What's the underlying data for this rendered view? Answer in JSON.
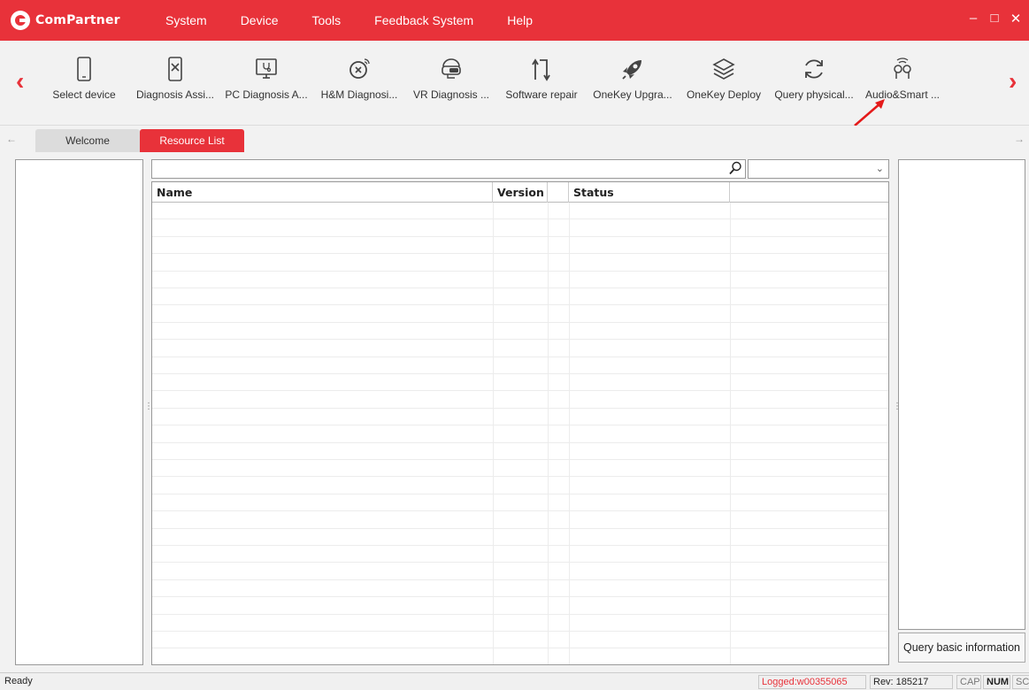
{
  "app": {
    "logo_text": "ComPartner",
    "brand_color": "#e8323a"
  },
  "menu": {
    "items": [
      "System",
      "Device",
      "Tools",
      "Feedback System",
      "Help"
    ]
  },
  "window_controls": {
    "minimize": "–",
    "maximize": "□",
    "close": "✕"
  },
  "toolbar": {
    "prev_arrow": "‹",
    "next_arrow": "›",
    "items": [
      {
        "label": "Select device",
        "icon": "phone-icon"
      },
      {
        "label": "Diagnosis Assi...",
        "icon": "diagnosis-phone-icon"
      },
      {
        "label": "PC Diagnosis A...",
        "icon": "pc-diagnosis-icon"
      },
      {
        "label": "H&M Diagnosi...",
        "icon": "watch-icon"
      },
      {
        "label": "VR Diagnosis ...",
        "icon": "vr-headset-icon"
      },
      {
        "label": "Software repair",
        "icon": "software-repair-icon"
      },
      {
        "label": "OneKey Upgra...",
        "icon": "rocket-icon"
      },
      {
        "label": "OneKey Deploy",
        "icon": "layers-icon"
      },
      {
        "label": "Query physical...",
        "icon": "refresh-icon"
      },
      {
        "label": "Audio&Smart ...",
        "icon": "earbuds-icon"
      }
    ]
  },
  "tabs": {
    "back_arrow": "←",
    "forward_arrow": "→",
    "items": [
      {
        "label": "Welcome",
        "active": false
      },
      {
        "label": "Resource List",
        "active": true
      }
    ]
  },
  "resource_list": {
    "search_value": "",
    "filter_value": "",
    "columns": [
      "Name",
      "Version",
      "",
      "Status",
      ""
    ],
    "rows": []
  },
  "right_panel": {
    "query_button": "Query basic information"
  },
  "statusbar": {
    "ready": "Ready",
    "logged": "Logged:w00355065",
    "rev": "Rev: 185217",
    "cap": "CAP",
    "num": "NUM",
    "scrl": "SCRL"
  }
}
